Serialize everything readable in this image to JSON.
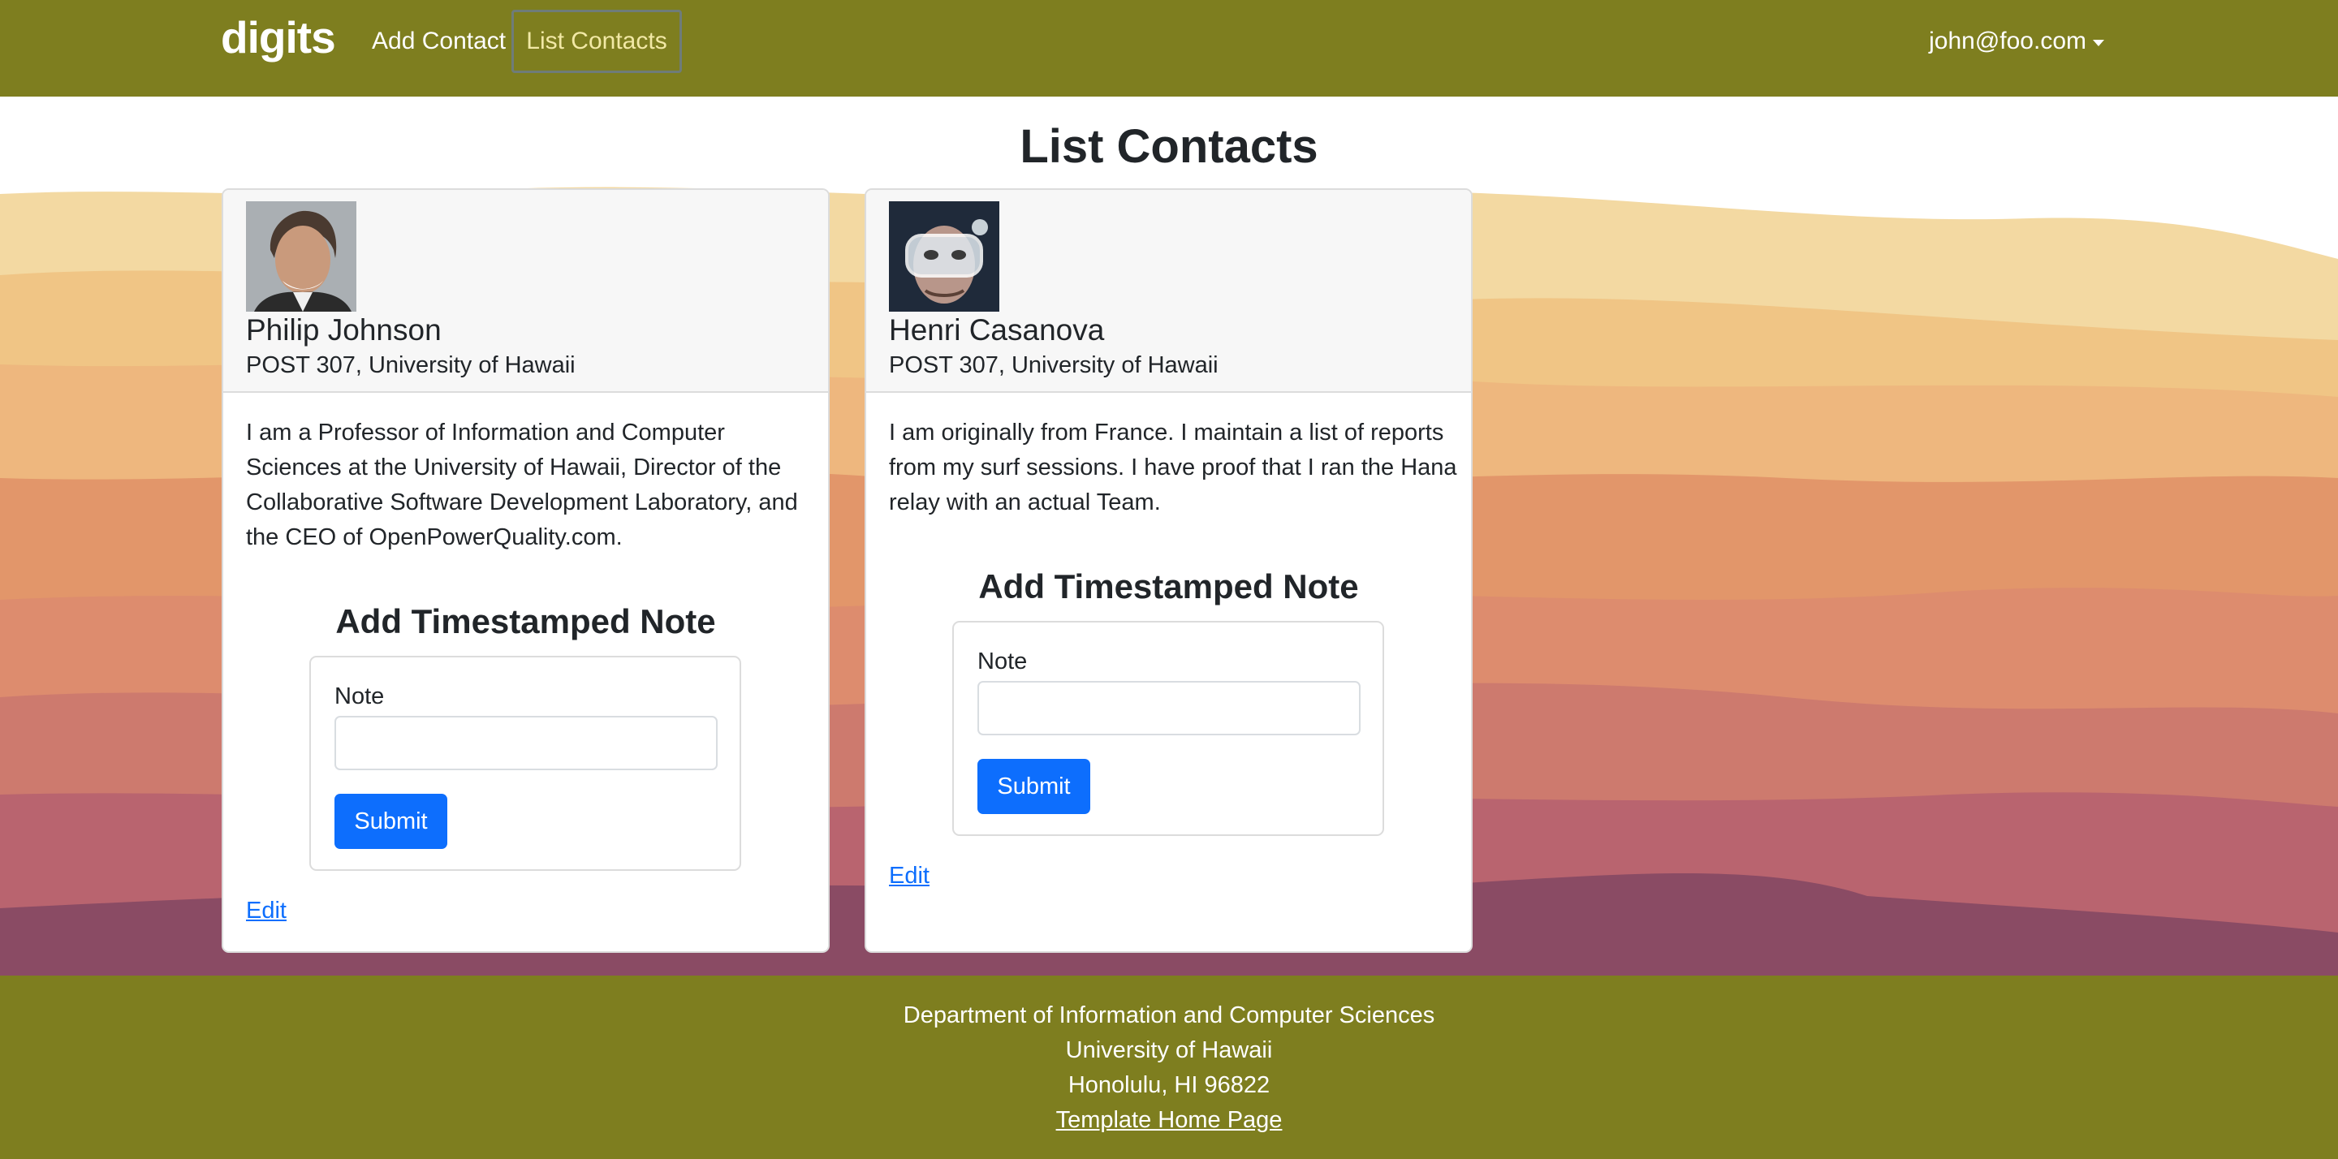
{
  "navbar": {
    "brand": "digits",
    "links": [
      {
        "label": "Add Contact"
      },
      {
        "label": "List Contacts",
        "active": true
      }
    ],
    "user": "john@foo.com",
    "color": "#7e7e1f"
  },
  "page": {
    "title": "List Contacts"
  },
  "contacts": [
    {
      "name": "Philip Johnson",
      "address": "POST 307, University of Hawaii",
      "description": "I am a Professor of Information and Computer Sciences at the University of Hawaii, Director of the Collaborative Software Development Laboratory, and the CEO of OpenPowerQuality.com.",
      "note_title": "Add Timestamped Note",
      "note_label": "Note",
      "note_value": "",
      "submit_label": "Submit",
      "edit_label": "Edit"
    },
    {
      "name": "Henri Casanova",
      "address": "POST 307, University of Hawaii",
      "description": "I am originally from France. I maintain a list of reports from my surf sessions. I have proof that I ran the Hana relay with an actual Team.",
      "note_title": "Add Timestamped Note",
      "note_label": "Note",
      "note_value": "",
      "submit_label": "Submit",
      "edit_label": "Edit"
    }
  ],
  "footer": {
    "lines": [
      "Department of Information and Computer Sciences",
      "University of Hawaii",
      "Honolulu, HI 96822"
    ],
    "link": "Template Home Page"
  },
  "colors": {
    "accent": "#0d6efd",
    "nav_active": "#f2e9a6"
  }
}
